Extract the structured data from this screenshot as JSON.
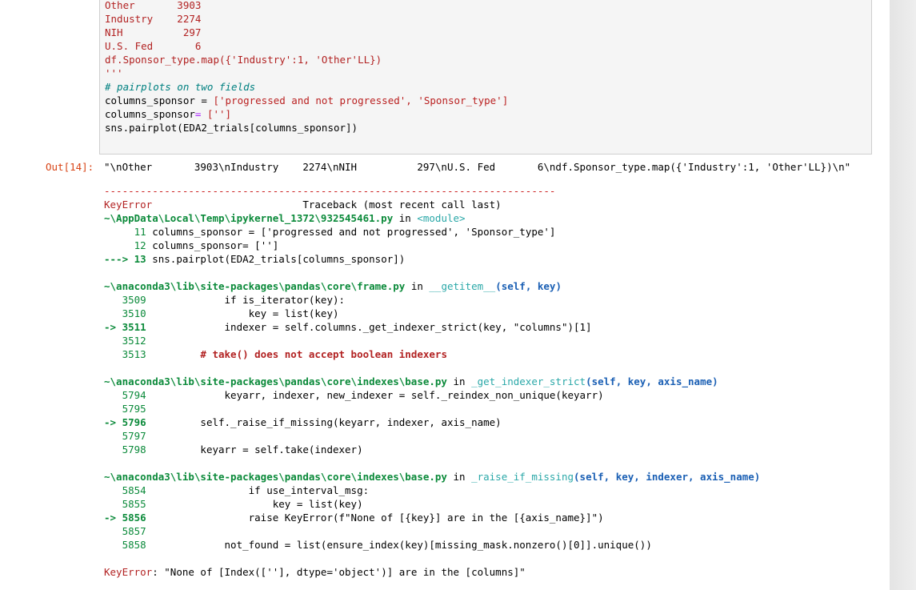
{
  "input_cell": {
    "lines": [
      "Other       3903",
      "Industry    2274",
      "NIH          297",
      "U.S. Fed       6",
      "df.Sponsor_type.map({'Industry':1, 'Other'LL})",
      "'''",
      "# pairplots on two fields",
      "columns_sponsor = ",
      "['progressed and not progressed', 'Sponsor_type']",
      "columns_sponsor",
      "= ",
      "['']",
      "sns.pairplot(EDA2_trials[columns_sponsor])"
    ]
  },
  "output": {
    "prompt": "Out[14]:",
    "value": "\"\\nOther       3903\\nIndustry    2274\\nNIH          297\\nU.S. Fed       6\\ndf.Sponsor_type.map({'Industry':1, 'Other'LL})\\n\""
  },
  "traceback": {
    "separator": "---------------------------------------------------------------------------",
    "error_name": "KeyError",
    "header_right": "                         Traceback (most recent call last)",
    "frames": [
      {
        "path": "~\\AppData\\Local\\Temp\\ipykernel_1372\\932545461.py",
        "in_word": " in ",
        "func": "<module>",
        "args": "",
        "lines": [
          {
            "marker": "     ",
            "num": "11",
            "code": " columns_sponsor = ['progressed and not progressed', 'Sponsor_type']"
          },
          {
            "marker": "     ",
            "num": "12",
            "code": " columns_sponsor= ['']"
          },
          {
            "marker": "---> ",
            "num": "13",
            "code": " sns.pairplot(EDA2_trials[columns_sponsor])"
          }
        ]
      },
      {
        "path": "~\\anaconda3\\lib\\site-packages\\pandas\\core\\frame.py",
        "in_word": " in ",
        "func": "__getitem__",
        "args": "(self, key)",
        "lines": [
          {
            "marker": "   ",
            "num": "3509",
            "code": "             if is_iterator(key):"
          },
          {
            "marker": "   ",
            "num": "3510",
            "code": "                 key = list(key)"
          },
          {
            "marker": "-> ",
            "num": "3511",
            "code": "             indexer = self.columns._get_indexer_strict(key, \"columns\")[1]"
          },
          {
            "marker": "   ",
            "num": "3512",
            "code": ""
          },
          {
            "marker": "   ",
            "num": "3513",
            "code": "         # take() does not accept boolean indexers"
          }
        ]
      },
      {
        "path": "~\\anaconda3\\lib\\site-packages\\pandas\\core\\indexes\\base.py",
        "in_word": " in ",
        "func": "_get_indexer_strict",
        "args": "(self, key, axis_name)",
        "lines": [
          {
            "marker": "   ",
            "num": "5794",
            "code": "             keyarr, indexer, new_indexer = self._reindex_non_unique(keyarr)"
          },
          {
            "marker": "   ",
            "num": "5795",
            "code": ""
          },
          {
            "marker": "-> ",
            "num": "5796",
            "code": "         self._raise_if_missing(keyarr, indexer, axis_name)"
          },
          {
            "marker": "   ",
            "num": "5797",
            "code": ""
          },
          {
            "marker": "   ",
            "num": "5798",
            "code": "         keyarr = self.take(indexer)"
          }
        ]
      },
      {
        "path": "~\\anaconda3\\lib\\site-packages\\pandas\\core\\indexes\\base.py",
        "in_word": " in ",
        "func": "_raise_if_missing",
        "args": "(self, key, indexer, axis_name)",
        "lines": [
          {
            "marker": "   ",
            "num": "5854",
            "code": "                 if use_interval_msg:"
          },
          {
            "marker": "   ",
            "num": "5855",
            "code": "                     key = list(key)"
          },
          {
            "marker": "-> ",
            "num": "5856",
            "code": "                 raise KeyError(f\"None of [{key}] are in the [{axis_name}]\")"
          },
          {
            "marker": "   ",
            "num": "5857",
            "code": ""
          },
          {
            "marker": "   ",
            "num": "5858",
            "code": "             not_found = list(ensure_index(key)[missing_mask.nonzero()[0]].unique())"
          }
        ]
      }
    ],
    "final_error_name": "KeyError",
    "final_message": ": \"None of [Index([''], dtype='object')] are in the [columns]\""
  }
}
